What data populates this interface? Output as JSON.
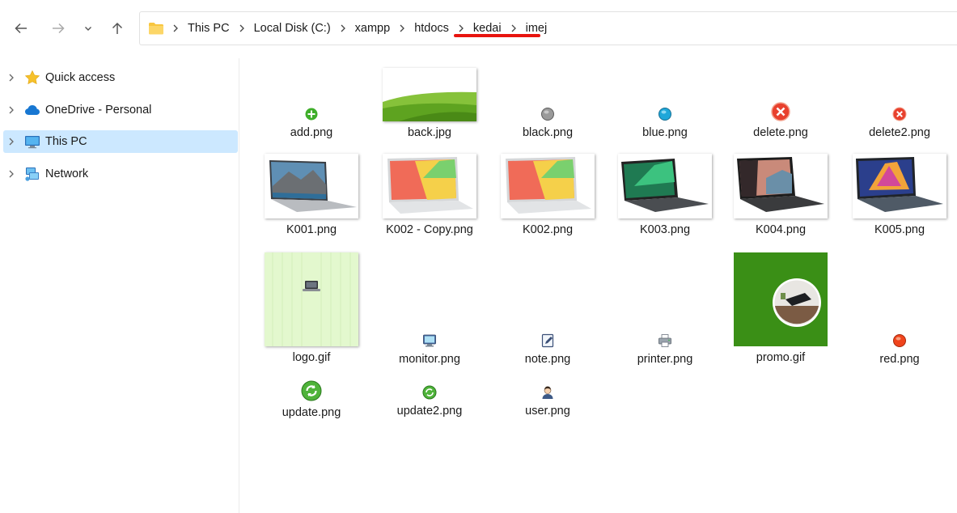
{
  "breadcrumb": {
    "items": [
      "This PC",
      "Local Disk (C:)",
      "xampp",
      "htdocs",
      "kedai",
      "imej"
    ]
  },
  "sidebar": {
    "items": [
      {
        "label": "Quick access",
        "icon": "star-icon"
      },
      {
        "label": "OneDrive - Personal",
        "icon": "cloud-icon"
      },
      {
        "label": "This PC",
        "icon": "monitor-icon"
      },
      {
        "label": "Network",
        "icon": "network-icon"
      }
    ]
  },
  "files": [
    {
      "name": "add.png",
      "icon": "add-icon"
    },
    {
      "name": "back.jpg",
      "icon": "green-wave-thumbnail"
    },
    {
      "name": "black.png",
      "icon": "grey-circle-icon"
    },
    {
      "name": "blue.png",
      "icon": "blue-circle-icon"
    },
    {
      "name": "delete.png",
      "icon": "delete-icon"
    },
    {
      "name": "delete2.png",
      "icon": "delete-icon"
    },
    {
      "name": "K001.png",
      "icon": "laptop-thumbnail"
    },
    {
      "name": "K002 - Copy.png",
      "icon": "laptop-thumbnail"
    },
    {
      "name": "K002.png",
      "icon": "laptop-thumbnail"
    },
    {
      "name": "K003.png",
      "icon": "laptop-thumbnail"
    },
    {
      "name": "K004.png",
      "icon": "laptop-thumbnail"
    },
    {
      "name": "K005.png",
      "icon": "laptop-thumbnail"
    },
    {
      "name": "logo.gif",
      "icon": "logo-thumbnail"
    },
    {
      "name": "monitor.png",
      "icon": "monitor-icon"
    },
    {
      "name": "note.png",
      "icon": "note-icon"
    },
    {
      "name": "printer.png",
      "icon": "printer-icon"
    },
    {
      "name": "promo.gif",
      "icon": "promo-thumbnail"
    },
    {
      "name": "red.png",
      "icon": "red-circle-icon"
    },
    {
      "name": "update.png",
      "icon": "update-icon"
    },
    {
      "name": "update2.png",
      "icon": "update-icon"
    },
    {
      "name": "user.png",
      "icon": "user-icon"
    }
  ],
  "colors": {
    "accent": "#e8140f",
    "selection": "#cce8ff",
    "folder": "#f8c640",
    "promo_green": "#3a8f16"
  }
}
